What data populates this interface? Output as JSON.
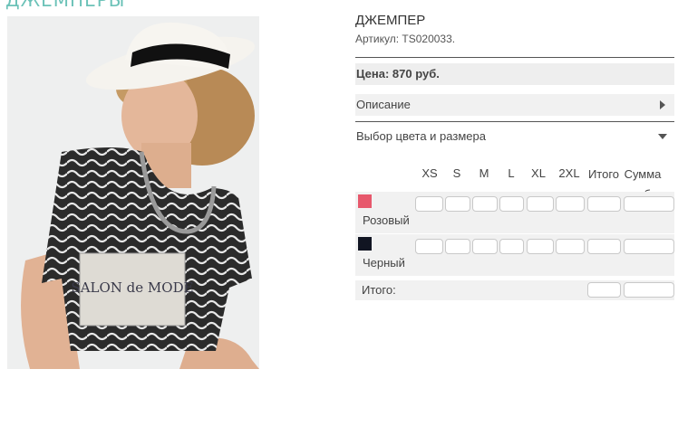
{
  "category": {
    "title": "ДЖЕМПЕРЫ"
  },
  "product": {
    "name": "ДЖЕМПЕР",
    "sku": "Артикул: TS020033.",
    "price": "Цена: 870 руб.",
    "print_text": "SALON de MODE"
  },
  "sections": {
    "description": "Описание",
    "size_picker": "Выбор цвета и размера"
  },
  "size_table": {
    "sizes": [
      "XS",
      "S",
      "M",
      "L",
      "XL",
      "2XL"
    ],
    "total_qty_line1": "Итого",
    "total_qty_line2": "штук",
    "sum_line1": "Сумма",
    "sum_line2": "руб.",
    "colors": [
      {
        "name": "Розовый",
        "swatch": "#e7586c"
      },
      {
        "name": "Черный",
        "swatch": "#111522"
      }
    ],
    "total_label": "Итого:"
  },
  "theme": {
    "accent": "#6cc2b8",
    "row_bg": "#f1f1f1",
    "price_bg": "#eeeeee"
  }
}
